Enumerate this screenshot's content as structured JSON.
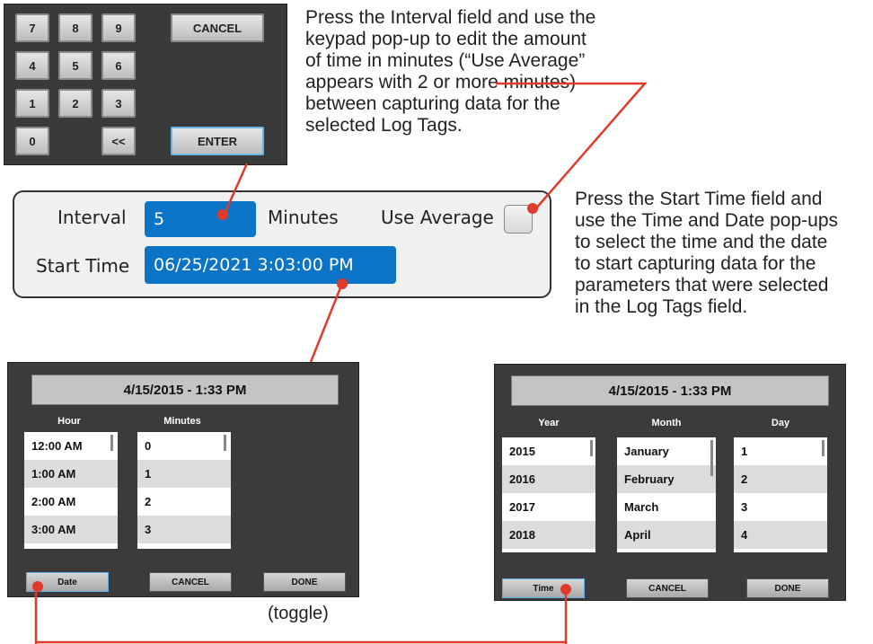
{
  "keypad": {
    "keys": [
      "7",
      "8",
      "9",
      "4",
      "5",
      "6",
      "1",
      "2",
      "3",
      "0",
      "<<"
    ],
    "cancel_label": "CANCEL",
    "enter_label": "ENTER"
  },
  "notes": {
    "interval": [
      "Press the Interval field and use the",
      "keypad pop-up to edit the amount",
      "of time in minutes (“Use Average”",
      "appears with 2 or more minutes)",
      "between capturing data for the",
      "selected Log Tags."
    ],
    "start_time": [
      "Press the Start Time field and",
      "use the Time and Date pop-ups",
      "to select the time and the date",
      "to start capturing data for the",
      "parameters that were selected",
      "in the Log Tags field."
    ],
    "toggle": "(toggle)"
  },
  "panel": {
    "interval_label": "Interval",
    "interval_value": "5",
    "minutes_label": "Minutes",
    "use_average_label": "Use Average",
    "start_time_label": "Start Time",
    "start_time_value": "06/25/2021 3:03:00 PM"
  },
  "time_dialog": {
    "title": "4/15/2015 - 1:33 PM",
    "hour_header": "Hour",
    "minutes_header": "Minutes",
    "hours": [
      "12:00 AM",
      "1:00 AM",
      "2:00 AM",
      "3:00 AM"
    ],
    "minutes": [
      "0",
      "1",
      "2",
      "3"
    ],
    "date_button": "Date",
    "cancel_button": "CANCEL",
    "done_button": "DONE"
  },
  "date_dialog": {
    "title": "4/15/2015 - 1:33 PM",
    "year_header": "Year",
    "month_header": "Month",
    "day_header": "Day",
    "years": [
      "2015",
      "2016",
      "2017",
      "2018"
    ],
    "months": [
      "January",
      "February",
      "March",
      "April"
    ],
    "days": [
      "1",
      "2",
      "3",
      "4"
    ],
    "time_button": "Time",
    "cancel_button": "CANCEL",
    "done_button": "DONE"
  },
  "colors": {
    "field_blue": "#0b74c6",
    "callout_red": "#e03a2a",
    "dialog_bg": "#3b3b3b"
  }
}
